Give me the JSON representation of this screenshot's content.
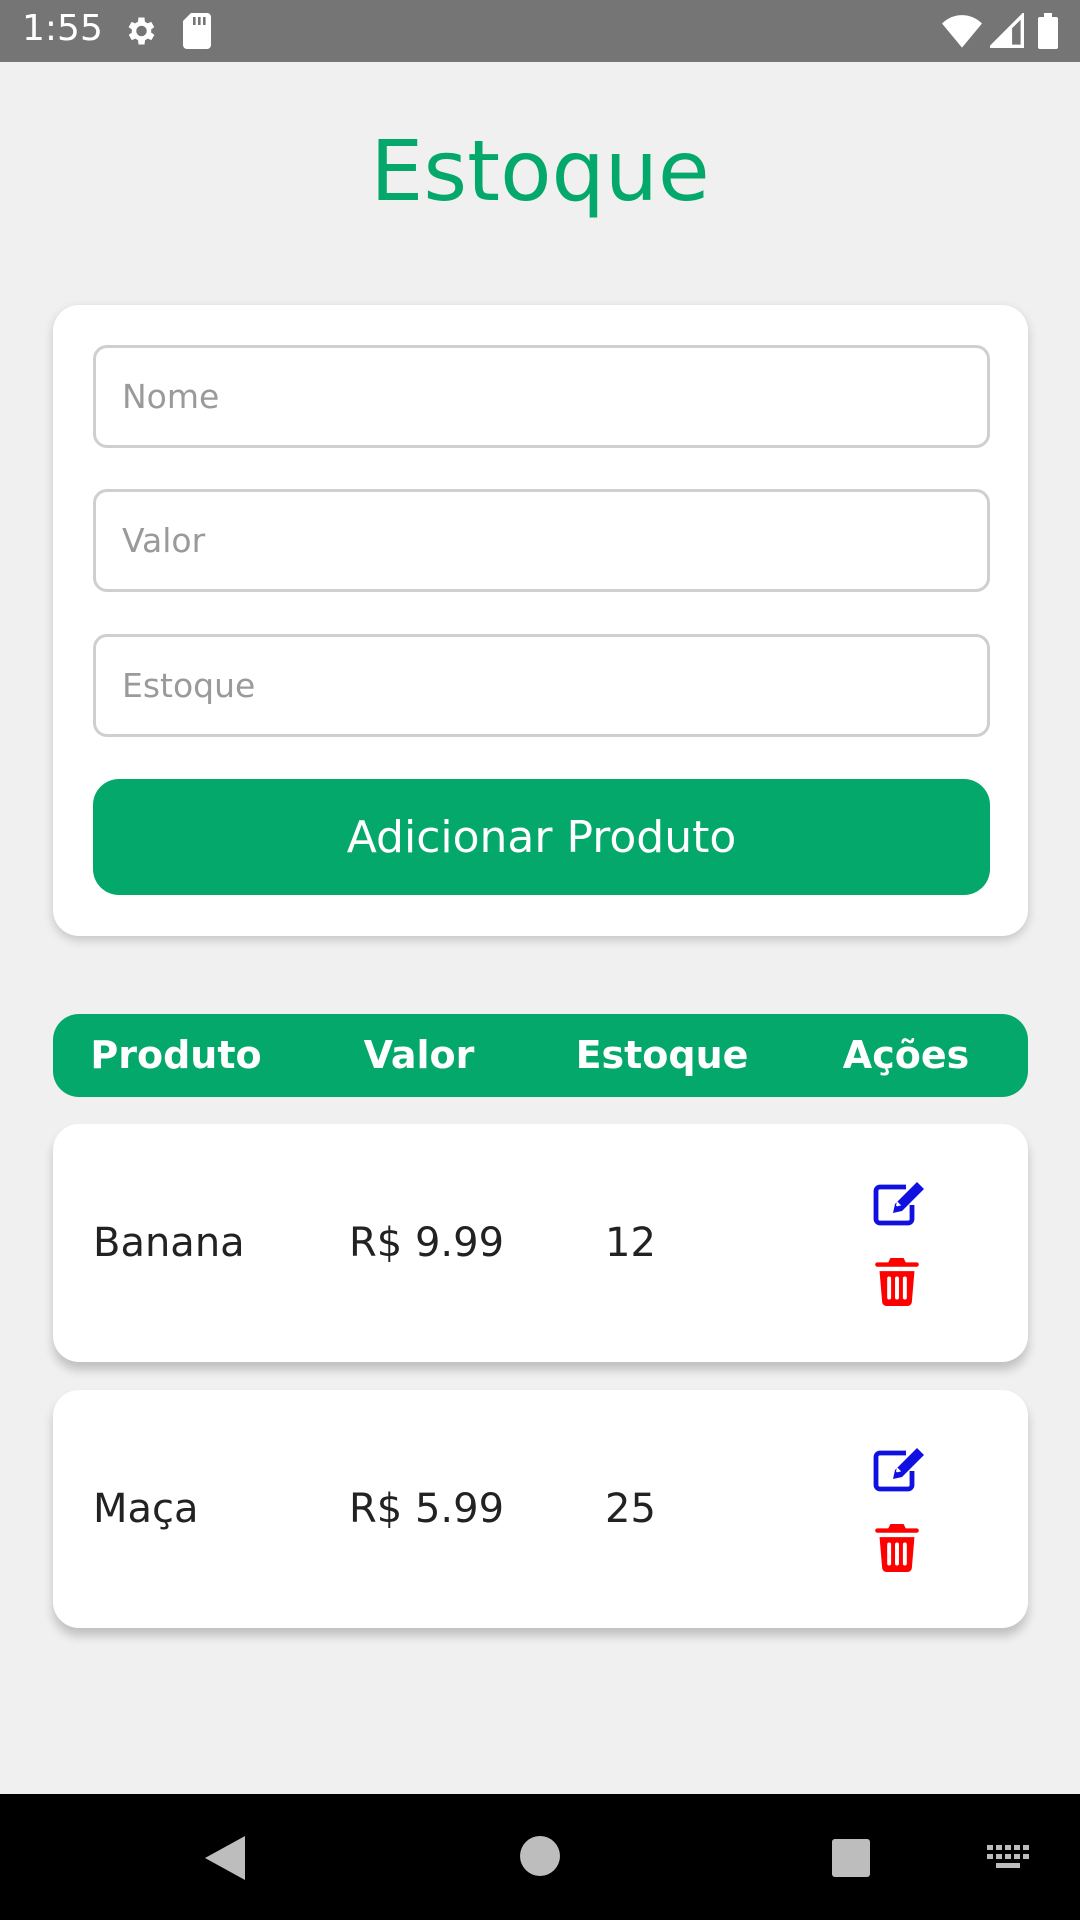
{
  "status_bar": {
    "time": "1:55"
  },
  "title": "Estoque",
  "form": {
    "nome_placeholder": "Nome",
    "valor_placeholder": "Valor",
    "estoque_placeholder": "Estoque",
    "add_button_label": "Adicionar Produto"
  },
  "table": {
    "headers": [
      "Produto",
      "Valor",
      "Estoque",
      "Ações"
    ],
    "rows": [
      {
        "name": "Banana",
        "value": "R$ 9.99",
        "stock": "12"
      },
      {
        "name": "Maça",
        "value": "R$ 5.99",
        "stock": "25"
      }
    ]
  },
  "colors": {
    "accent": "#05a86b",
    "edit_icon": "#1010e0",
    "delete_icon": "#ff0000"
  }
}
